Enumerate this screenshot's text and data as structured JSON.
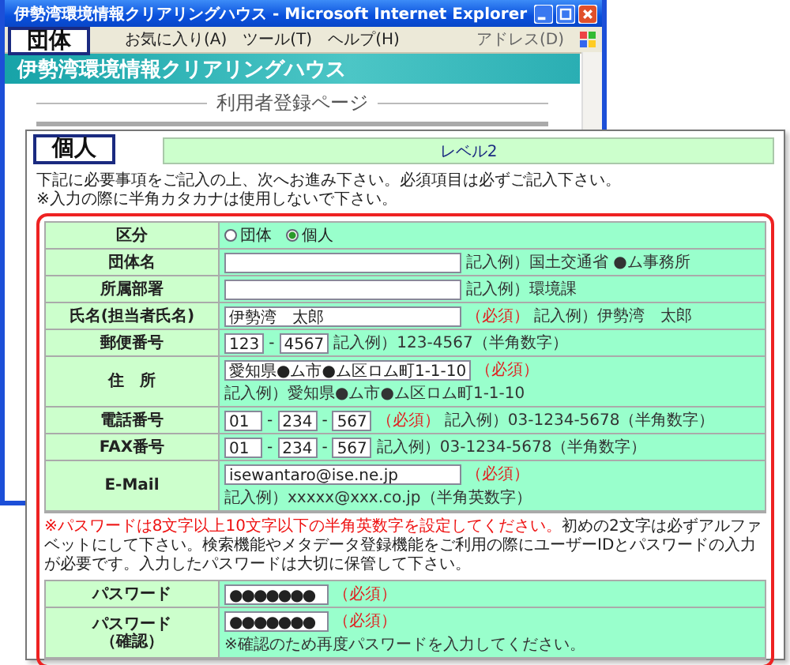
{
  "back_window": {
    "title": "伊勢湾環境情報クリアリングハウス - Microsoft Internet Explorer",
    "caption": "団体",
    "menu": [
      "お気に入り(A)",
      "ツール(T)",
      "ヘルプ(H)"
    ],
    "address_label": "アドレス(D)",
    "banner": "伊勢湾環境情報クリアリングハウス",
    "page_heading": "利用者登録ページ"
  },
  "front_window": {
    "caption": "個人",
    "level_heading": "レベル2",
    "intro": [
      "下記に必要事項をご記入の上、次へお進み下さい。必須項目は必ずご記入下さい。",
      "※入力の際に半角カタカナは使用しないで下さい。"
    ],
    "fields": [
      {
        "kind": "radio",
        "label": "区分",
        "options": [
          {
            "label": "団体",
            "selected": false
          },
          {
            "label": "個人",
            "selected": true
          }
        ]
      },
      {
        "kind": "text",
        "label": "団体名",
        "example": "記入例）国土交通省 ●ム事務所"
      },
      {
        "kind": "text",
        "label": "所属部署",
        "example": "記入例）環境課"
      },
      {
        "kind": "text",
        "label": "氏名(担当者氏名)",
        "value": "伊勢湾　太郎",
        "required_mark": "（必須）",
        "example": "記入例）伊勢湾　太郎"
      },
      {
        "kind": "split",
        "label": "郵便番号",
        "values": [
          "123",
          "4567"
        ],
        "separator": "-",
        "example": "記入例）123-4567（半角数字）"
      },
      {
        "kind": "text",
        "label": "住　所",
        "value": "愛知県●ム市●ム区ロム町1-1-10",
        "required_mark": "（必須）",
        "example": "記入例）愛知県●ム市●ム区ロム町1-1-10"
      },
      {
        "kind": "split",
        "label": "電話番号",
        "values": [
          "01",
          "234",
          "567"
        ],
        "separator": "-",
        "required_mark": "（必須）",
        "example": "記入例）03-1234-5678（半角数字）"
      },
      {
        "kind": "split",
        "label": "FAX番号",
        "values": [
          "01",
          "234",
          "567"
        ],
        "separator": "-",
        "example": "記入例）03-1234-5678（半角数字）"
      },
      {
        "kind": "text",
        "label": "E-Mail",
        "value": "isewantaro@ise.ne.jp",
        "required_mark": "（必須）",
        "example": "記入例）xxxxx@xxx.co.jp（半角英数字）"
      }
    ],
    "password_rule": {
      "warning": "※パスワードは8文字以上10文字以下の半角英数字を設定してください。",
      "text": "初めの2文字は必ずアルファベットにして下さい。検索機能やメタデータ登録機能をご利用の際にユーザーIDとパスワードの入力が必要です。入力したパスワードは大切に保管して下さい。"
    },
    "password_fields": [
      {
        "label": "パスワード",
        "value": "●●●●●●●",
        "required_mark": "（必須）"
      },
      {
        "label": "パスワード",
        "sublabel": "（確認）",
        "value": "●●●●●●●",
        "required_mark": "（必須）",
        "hint": "※確認のため再度パスワードを入力してください。"
      }
    ]
  }
}
